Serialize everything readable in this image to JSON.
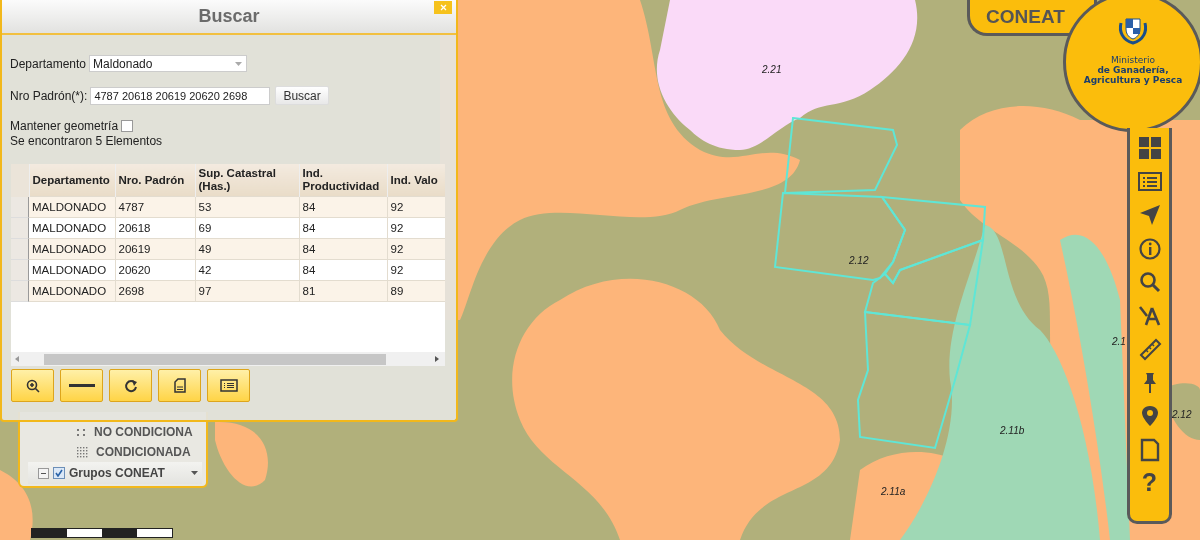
{
  "map": {
    "labels": [
      "2.21",
      "2.12",
      "2.1",
      "2.11b",
      "2.11a",
      "2.12"
    ]
  },
  "dialog": {
    "title": "Buscar",
    "department": {
      "label": "Departamento",
      "value": "Maldonado"
    },
    "padron": {
      "label": "Nro Padrón(*):",
      "value": "4787 20618 20619 20620 2698",
      "button": "Buscar"
    },
    "keep_geometry": {
      "label": "Mantener geometría",
      "checked": false
    },
    "result_text": "Se encontraron 5 Elementos",
    "table": {
      "columns": [
        "Departamento",
        "Nro. Padrón",
        "Sup. Catastral (Has.)",
        "Ind. Productividad",
        "Ind. Valo"
      ],
      "rows": [
        [
          "MALDONADO",
          "4787",
          "53",
          "84",
          "92"
        ],
        [
          "MALDONADO",
          "20618",
          "69",
          "84",
          "92"
        ],
        [
          "MALDONADO",
          "20619",
          "49",
          "84",
          "92"
        ],
        [
          "MALDONADO",
          "20620",
          "42",
          "84",
          "92"
        ],
        [
          "MALDONADO",
          "2698",
          "97",
          "81",
          "89"
        ]
      ]
    }
  },
  "legend": {
    "items": [
      {
        "label": "NO CONDICIONA",
        "kind": "sparse"
      },
      {
        "label": "CONDICIONADA",
        "kind": "dense"
      }
    ],
    "layer": {
      "label": "Grupos CONEAT",
      "checked": true,
      "expanded": true
    }
  },
  "header": {
    "app_name": "CONEAT",
    "ministry_light": "Ministerio",
    "ministry_bold": "de Ganadería, Agricultura y Pesca"
  },
  "sidebar": {
    "help_label": "?"
  }
}
